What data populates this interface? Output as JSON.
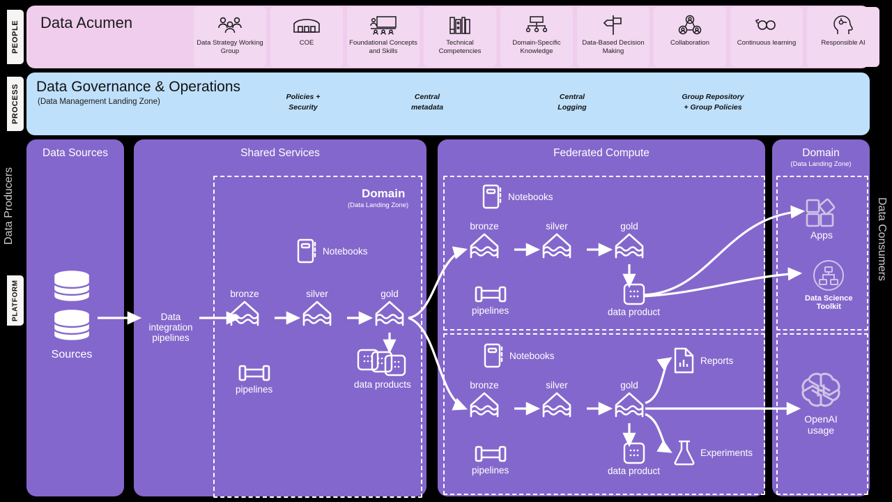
{
  "bands": {
    "people": {
      "tab": "PEOPLE",
      "title": "Data Acumen",
      "cards": [
        {
          "label": "Data Strategy Working Group",
          "icon": "people-group-icon"
        },
        {
          "label": "COE",
          "icon": "building-icon"
        },
        {
          "label": "Foundational Concepts and Skills",
          "icon": "classroom-board-icon"
        },
        {
          "label": "Technical Competencies",
          "icon": "bookshelf-icon"
        },
        {
          "label": "Domain-Specific Knowledge",
          "icon": "hierarchy-tree-icon"
        },
        {
          "label": "Data-Based Decision Making",
          "icon": "signpost-icon"
        },
        {
          "label": "Collaboration",
          "icon": "collaboration-network-icon"
        },
        {
          "label": "Continuous learning",
          "icon": "infinity-loop-icon"
        },
        {
          "label": "Responsible AI",
          "icon": "head-gear-icon"
        }
      ]
    },
    "process": {
      "tab": "PROCESS",
      "title": "Data Governance & Operations",
      "subtitle": "(Data Management Landing Zone)",
      "items": [
        {
          "line1": "Policies  +",
          "line2": "Security"
        },
        {
          "line1": "Central",
          "line2": "metadata"
        },
        {
          "line1": "Central",
          "line2": "Logging"
        },
        {
          "line1": "Group  Repository",
          "line2": "+ Group  Policies"
        }
      ]
    },
    "platform": {
      "tab": "PLATFORM"
    }
  },
  "outer_labels": {
    "producers": "Data Producers",
    "consumers": "Data Consumers"
  },
  "panels": {
    "sources": {
      "title": "Data Sources",
      "node_label": "Sources",
      "node_icon": "database-stack-icon",
      "integration_label_line1": "Data",
      "integration_label_line2": "integration",
      "integration_label_line3": "pipelines"
    },
    "shared": {
      "title": "Shared Services",
      "zone_title": "Domain",
      "zone_sub": "(Data Landing Zone)",
      "notebooks": "Notebooks",
      "notebooks_icon": "notebook-icon",
      "pipelines": "pipelines",
      "pipelines_icon": "pipeline-icon",
      "medallion": [
        "bronze",
        "silver",
        "gold"
      ],
      "medallion_icon": "lakehouse-icon",
      "data_products": "data products",
      "data_products_icon": "data-products-stack-icon"
    },
    "federated": {
      "title": "Federated Compute",
      "top": {
        "notebooks": "Notebooks",
        "notebooks_icon": "notebook-icon",
        "pipelines": "pipelines",
        "pipelines_icon": "pipeline-icon",
        "medallion": [
          "bronze",
          "silver",
          "gold"
        ],
        "medallion_icon": "lakehouse-icon",
        "data_product": "data product",
        "data_product_icon": "data-product-icon"
      },
      "bottom": {
        "notebooks": "Notebooks",
        "notebooks_icon": "notebook-icon",
        "pipelines": "pipelines",
        "pipelines_icon": "pipeline-icon",
        "medallion": [
          "bronze",
          "silver",
          "gold"
        ],
        "medallion_icon": "lakehouse-icon",
        "data_product": "data product",
        "data_product_icon": "data-product-icon",
        "reports": "Reports",
        "reports_icon": "report-document-icon",
        "experiments": "Experiments",
        "experiments_icon": "flask-icon"
      }
    },
    "domain_right": {
      "title": "Domain",
      "subtitle": "(Data Landing Zone)",
      "apps": "Apps",
      "apps_icon": "apps-grid-icon",
      "toolkit_line1": "Data Science",
      "toolkit_line2": "Toolkit",
      "toolkit_icon": "data-science-toolkit-icon",
      "openai_line1": "OpenAI",
      "openai_line2": "usage",
      "openai_icon": "openai-logo-icon"
    }
  },
  "colors": {
    "background": "#000000",
    "people_band": "#f0cdec",
    "people_card": "#f3d8f1",
    "process_band": "#bfe0fb",
    "panel_purple": "#8467cc",
    "stroke_white": "#ffffff",
    "tab_background": "#f7f5f3",
    "outer_label": "#c9c9cf",
    "muted_icon": "#cfc5e6"
  }
}
